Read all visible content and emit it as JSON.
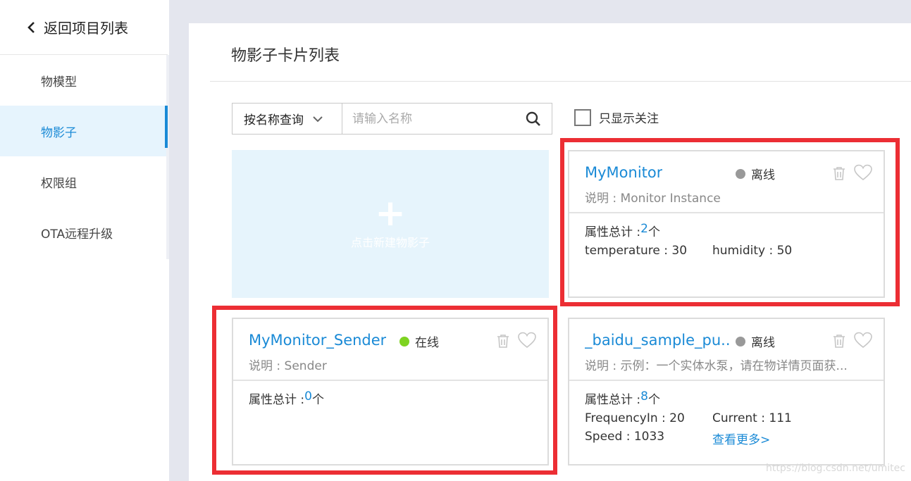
{
  "nav": {
    "back_label": "返回项目列表",
    "items": [
      {
        "label": "物模型"
      },
      {
        "label": "物影子"
      },
      {
        "label": "权限组"
      },
      {
        "label": "OTA远程升级"
      }
    ],
    "active_index": 1
  },
  "main": {
    "title": "物影子卡片列表",
    "search": {
      "select_label": "按名称查询",
      "placeholder": "请输入名称"
    },
    "follow_only_label": "只显示关注",
    "follow_only_checked": false,
    "new_card_label": "点击新建物影子",
    "new_card_plus": "+",
    "cards": [
      {
        "name": "MyMonitor",
        "status": "离线",
        "status_color": "#999999",
        "desc_prefix": "说明 : ",
        "desc": "Monitor Instance",
        "attr_prefix": "属性总计 : ",
        "attr_count": "2",
        "attr_unit": "个",
        "attrs": [
          {
            "label": "temperature : 30"
          },
          {
            "label": "humidity : 50"
          }
        ]
      },
      {
        "name": "MyMonitor_Sender",
        "status": "在线",
        "status_color": "#7ed321",
        "desc_prefix": "说明 : ",
        "desc": "Sender",
        "attr_prefix": "属性总计 : ",
        "attr_count": "0",
        "attr_unit": "个",
        "attrs": []
      },
      {
        "name": "_baidu_sample_pu...",
        "status": "离线",
        "status_color": "#999999",
        "desc_prefix": "说明 : ",
        "desc": "示例：一个实体水泵，请在物详情页面获...",
        "attr_prefix": "属性总计 : ",
        "attr_count": "8",
        "attr_unit": "个",
        "attrs": [
          {
            "label": "FrequencyIn : 20"
          },
          {
            "label": "Current : 111"
          },
          {
            "label": "Speed : 1033"
          }
        ],
        "more_label": "查看更多>"
      }
    ]
  },
  "highlight_color": "#ec2e34",
  "watermark": "https://blog.csdn.net/umitec"
}
